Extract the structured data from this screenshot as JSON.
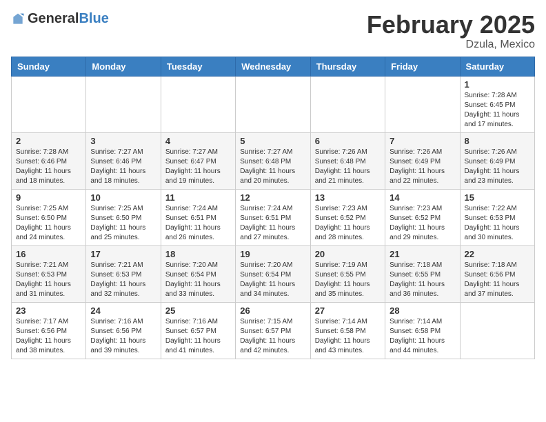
{
  "header": {
    "logo_general": "General",
    "logo_blue": "Blue",
    "title": "February 2025",
    "subtitle": "Dzula, Mexico"
  },
  "days_of_week": [
    "Sunday",
    "Monday",
    "Tuesday",
    "Wednesday",
    "Thursday",
    "Friday",
    "Saturday"
  ],
  "weeks": [
    [
      {
        "day": "",
        "info": ""
      },
      {
        "day": "",
        "info": ""
      },
      {
        "day": "",
        "info": ""
      },
      {
        "day": "",
        "info": ""
      },
      {
        "day": "",
        "info": ""
      },
      {
        "day": "",
        "info": ""
      },
      {
        "day": "1",
        "info": "Sunrise: 7:28 AM\nSunset: 6:45 PM\nDaylight: 11 hours\nand 17 minutes."
      }
    ],
    [
      {
        "day": "2",
        "info": "Sunrise: 7:28 AM\nSunset: 6:46 PM\nDaylight: 11 hours\nand 18 minutes."
      },
      {
        "day": "3",
        "info": "Sunrise: 7:27 AM\nSunset: 6:46 PM\nDaylight: 11 hours\nand 18 minutes."
      },
      {
        "day": "4",
        "info": "Sunrise: 7:27 AM\nSunset: 6:47 PM\nDaylight: 11 hours\nand 19 minutes."
      },
      {
        "day": "5",
        "info": "Sunrise: 7:27 AM\nSunset: 6:48 PM\nDaylight: 11 hours\nand 20 minutes."
      },
      {
        "day": "6",
        "info": "Sunrise: 7:26 AM\nSunset: 6:48 PM\nDaylight: 11 hours\nand 21 minutes."
      },
      {
        "day": "7",
        "info": "Sunrise: 7:26 AM\nSunset: 6:49 PM\nDaylight: 11 hours\nand 22 minutes."
      },
      {
        "day": "8",
        "info": "Sunrise: 7:26 AM\nSunset: 6:49 PM\nDaylight: 11 hours\nand 23 minutes."
      }
    ],
    [
      {
        "day": "9",
        "info": "Sunrise: 7:25 AM\nSunset: 6:50 PM\nDaylight: 11 hours\nand 24 minutes."
      },
      {
        "day": "10",
        "info": "Sunrise: 7:25 AM\nSunset: 6:50 PM\nDaylight: 11 hours\nand 25 minutes."
      },
      {
        "day": "11",
        "info": "Sunrise: 7:24 AM\nSunset: 6:51 PM\nDaylight: 11 hours\nand 26 minutes."
      },
      {
        "day": "12",
        "info": "Sunrise: 7:24 AM\nSunset: 6:51 PM\nDaylight: 11 hours\nand 27 minutes."
      },
      {
        "day": "13",
        "info": "Sunrise: 7:23 AM\nSunset: 6:52 PM\nDaylight: 11 hours\nand 28 minutes."
      },
      {
        "day": "14",
        "info": "Sunrise: 7:23 AM\nSunset: 6:52 PM\nDaylight: 11 hours\nand 29 minutes."
      },
      {
        "day": "15",
        "info": "Sunrise: 7:22 AM\nSunset: 6:53 PM\nDaylight: 11 hours\nand 30 minutes."
      }
    ],
    [
      {
        "day": "16",
        "info": "Sunrise: 7:21 AM\nSunset: 6:53 PM\nDaylight: 11 hours\nand 31 minutes."
      },
      {
        "day": "17",
        "info": "Sunrise: 7:21 AM\nSunset: 6:53 PM\nDaylight: 11 hours\nand 32 minutes."
      },
      {
        "day": "18",
        "info": "Sunrise: 7:20 AM\nSunset: 6:54 PM\nDaylight: 11 hours\nand 33 minutes."
      },
      {
        "day": "19",
        "info": "Sunrise: 7:20 AM\nSunset: 6:54 PM\nDaylight: 11 hours\nand 34 minutes."
      },
      {
        "day": "20",
        "info": "Sunrise: 7:19 AM\nSunset: 6:55 PM\nDaylight: 11 hours\nand 35 minutes."
      },
      {
        "day": "21",
        "info": "Sunrise: 7:18 AM\nSunset: 6:55 PM\nDaylight: 11 hours\nand 36 minutes."
      },
      {
        "day": "22",
        "info": "Sunrise: 7:18 AM\nSunset: 6:56 PM\nDaylight: 11 hours\nand 37 minutes."
      }
    ],
    [
      {
        "day": "23",
        "info": "Sunrise: 7:17 AM\nSunset: 6:56 PM\nDaylight: 11 hours\nand 38 minutes."
      },
      {
        "day": "24",
        "info": "Sunrise: 7:16 AM\nSunset: 6:56 PM\nDaylight: 11 hours\nand 39 minutes."
      },
      {
        "day": "25",
        "info": "Sunrise: 7:16 AM\nSunset: 6:57 PM\nDaylight: 11 hours\nand 41 minutes."
      },
      {
        "day": "26",
        "info": "Sunrise: 7:15 AM\nSunset: 6:57 PM\nDaylight: 11 hours\nand 42 minutes."
      },
      {
        "day": "27",
        "info": "Sunrise: 7:14 AM\nSunset: 6:58 PM\nDaylight: 11 hours\nand 43 minutes."
      },
      {
        "day": "28",
        "info": "Sunrise: 7:14 AM\nSunset: 6:58 PM\nDaylight: 11 hours\nand 44 minutes."
      },
      {
        "day": "",
        "info": ""
      }
    ]
  ]
}
